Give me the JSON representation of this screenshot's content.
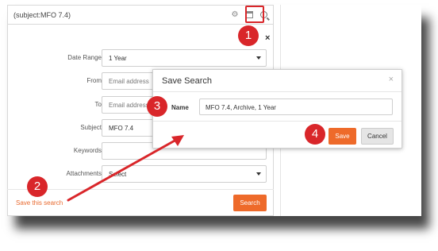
{
  "search_bar": {
    "query": "(subject:MFO 7.4)",
    "icons": [
      "gear-icon",
      "saved-searches-icon",
      "search-icon"
    ]
  },
  "form": {
    "fields": [
      {
        "label": "Date Range",
        "value": "1 Year",
        "type": "select"
      },
      {
        "label": "From",
        "value": "Email address",
        "type": "text",
        "placeholder": true
      },
      {
        "label": "To",
        "value": "Email address",
        "type": "text",
        "placeholder": true
      },
      {
        "label": "Subject",
        "value": "MFO 7.4",
        "type": "text"
      },
      {
        "label": "Keywords",
        "value": "",
        "type": "text"
      },
      {
        "label": "Attachments",
        "value": "Select",
        "type": "select"
      }
    ],
    "close_icon": "×",
    "save_link": "Save this search",
    "search_button": "Search"
  },
  "modal": {
    "title": "Save Search",
    "close_icon": "×",
    "name_label": "Name",
    "name_value": "MFO 7.4, Archive, 1 Year",
    "save_button": "Save",
    "cancel_button": "Cancel"
  },
  "steps": [
    "1",
    "2",
    "3",
    "4"
  ],
  "colors": {
    "accent_orange": "#ee6a2a",
    "marker_red": "#d9262a",
    "link_orange": "#e8692e"
  }
}
